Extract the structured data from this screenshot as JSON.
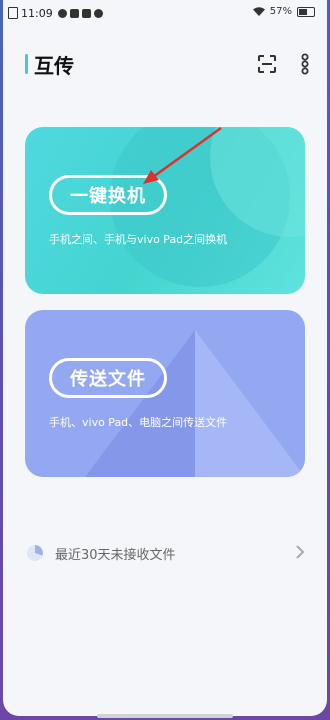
{
  "status_bar": {
    "time": "11:09",
    "battery": "57%"
  },
  "header": {
    "title": "互传",
    "scan_icon": "scan-icon",
    "more_icon": "more-vertical-icon"
  },
  "cards": [
    {
      "button_label": "一键换机",
      "subtitle": "手机之间、手机与vivo Pad之间换机"
    },
    {
      "button_label": "传送文件",
      "subtitle": "手机、vivo Pad、电脑之间传送文件"
    }
  ],
  "recent": {
    "label": "最近30天未接收文件",
    "icon": "pie-clock-icon",
    "arrow_icon": "chevron-right-icon"
  },
  "colors": {
    "accent": "#4fc4d6",
    "card1": "#45d4d0",
    "card2": "#94a8f2",
    "annotation_arrow": "#e0302b"
  }
}
